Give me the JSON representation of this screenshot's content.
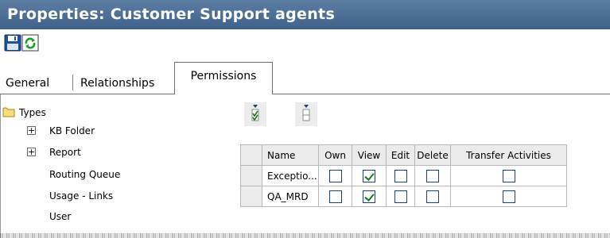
{
  "window": {
    "title": "Properties: Customer Support agents"
  },
  "toolbar": {
    "save_icon": "save-icon",
    "refresh_icon": "refresh-icon"
  },
  "tabs": [
    {
      "label": "General",
      "active": false
    },
    {
      "label": "Relationships",
      "active": false
    },
    {
      "label": "Permissions",
      "active": true
    }
  ],
  "tree": {
    "root": {
      "label": "Types",
      "icon": "folder-icon"
    },
    "items": [
      {
        "label": "KB Folder",
        "expandable": true
      },
      {
        "label": "Report",
        "expandable": true
      },
      {
        "label": "Routing Queue",
        "expandable": false,
        "selected": true
      },
      {
        "label": "Usage - Links",
        "expandable": false
      },
      {
        "label": "User",
        "expandable": false
      }
    ]
  },
  "actions": {
    "check_all_icon": "check-all-icon",
    "uncheck_all_icon": "uncheck-all-icon"
  },
  "grid": {
    "columns": [
      "Name",
      "Own",
      "View",
      "Edit",
      "Delete",
      "Transfer Activities"
    ],
    "rows": [
      {
        "name": "Exceptio...",
        "own": false,
        "view": true,
        "edit": false,
        "delete": false,
        "transfer": false
      },
      {
        "name": "QA_MRD",
        "own": false,
        "view": true,
        "edit": false,
        "delete": false,
        "transfer": false
      }
    ]
  },
  "colors": {
    "titlebar": "#3f6189",
    "accent": "#1c3f78",
    "check": "#1a7a1a"
  }
}
